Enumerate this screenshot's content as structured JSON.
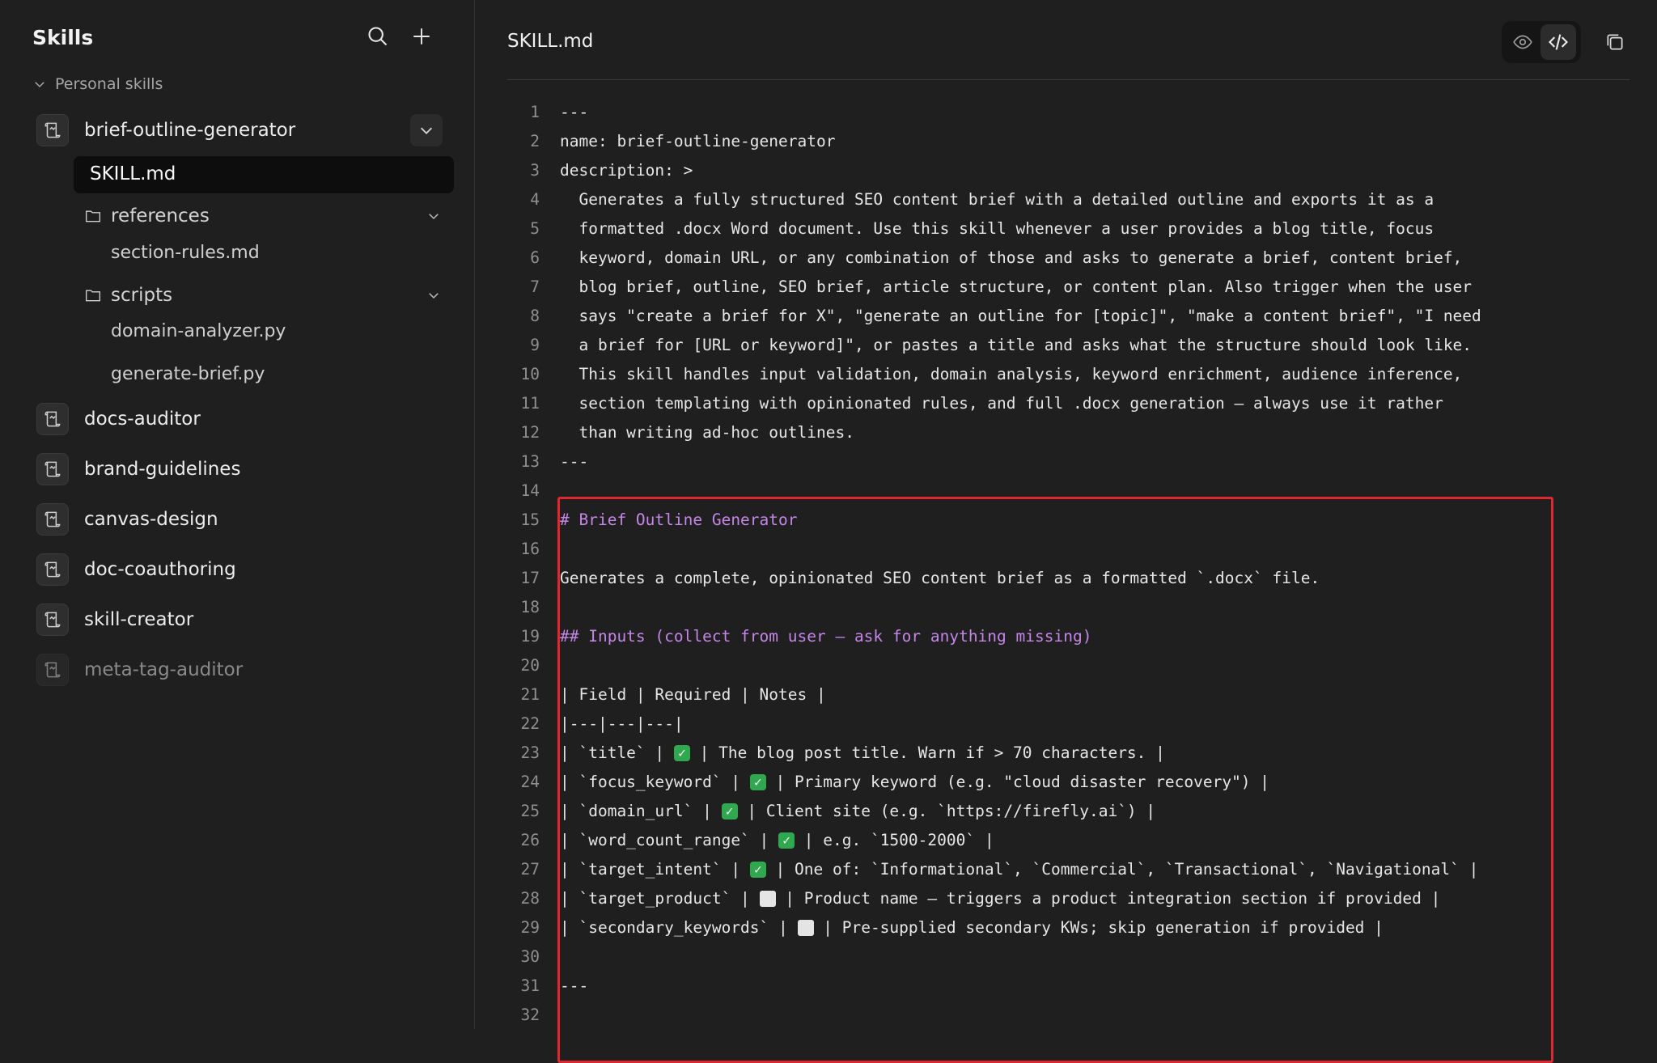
{
  "sidebar": {
    "title": "Skills",
    "section_label": "Personal skills",
    "skills": [
      {
        "label": "brief-outline-generator"
      },
      {
        "label": "docs-auditor"
      },
      {
        "label": "brand-guidelines"
      },
      {
        "label": "canvas-design"
      },
      {
        "label": "doc-coauthoring"
      },
      {
        "label": "skill-creator"
      },
      {
        "label": "meta-tag-auditor"
      }
    ],
    "files": {
      "active": "SKILL.md",
      "folder_references": "references",
      "file_section_rules": "section-rules.md",
      "folder_scripts": "scripts",
      "file_domain_analyzer": "domain-analyzer.py",
      "file_generate_brief": "generate-brief.py"
    }
  },
  "main": {
    "file_title": "SKILL.md"
  },
  "editor": {
    "lines": [
      {
        "n": "1",
        "t": "---"
      },
      {
        "n": "2",
        "t": "name: brief-outline-generator"
      },
      {
        "n": "3",
        "t": "description: >"
      },
      {
        "n": "4",
        "t": "  Generates a fully structured SEO content brief with a detailed outline and exports it as a"
      },
      {
        "n": "5",
        "t": "  formatted .docx Word document. Use this skill whenever a user provides a blog title, focus"
      },
      {
        "n": "6",
        "t": "  keyword, domain URL, or any combination of those and asks to generate a brief, content brief,"
      },
      {
        "n": "7",
        "t": "  blog brief, outline, SEO brief, article structure, or content plan. Also trigger when the user"
      },
      {
        "n": "8",
        "t": "  says \"create a brief for X\", \"generate an outline for [topic]\", \"make a content brief\", \"I need"
      },
      {
        "n": "9",
        "t": "  a brief for [URL or keyword]\", or pastes a title and asks what the structure should look like."
      },
      {
        "n": "10",
        "t": "  This skill handles input validation, domain analysis, keyword enrichment, audience inference,"
      },
      {
        "n": "11",
        "t": "  section templating with opinionated rules, and full .docx generation — always use it rather"
      },
      {
        "n": "12",
        "t": "  than writing ad-hoc outlines."
      },
      {
        "n": "13",
        "t": "---"
      },
      {
        "n": "14",
        "t": ""
      },
      {
        "n": "15",
        "t": "# Brief Outline Generator"
      },
      {
        "n": "16",
        "t": ""
      },
      {
        "n": "17",
        "t": "Generates a complete, opinionated SEO content brief as a formatted `.docx` file."
      },
      {
        "n": "18",
        "t": ""
      },
      {
        "n": "19",
        "t": "## Inputs (collect from user — ask for anything missing)"
      },
      {
        "n": "20",
        "t": ""
      },
      {
        "n": "21",
        "t": "| Field | Required | Notes |"
      },
      {
        "n": "22",
        "t": "|---|---|---|"
      },
      {
        "n": "23",
        "a": "| `title` | ",
        "b": " | The blog post title. Warn if > 70 characters. |"
      },
      {
        "n": "24",
        "a": "| `focus_keyword` | ",
        "b": " | Primary keyword (e.g. \"cloud disaster recovery\") |"
      },
      {
        "n": "25",
        "a": "| `domain_url` | ",
        "b": " | Client site (e.g. `https://firefly.ai`) |"
      },
      {
        "n": "26",
        "a": "| `word_count_range` | ",
        "b": " | e.g. `1500-2000` |"
      },
      {
        "n": "27",
        "a": "| `target_intent` | ",
        "b": " | One of: `Informational`, `Commercial`, `Transactional`, `Navigational` |"
      },
      {
        "n": "28",
        "a": "| `target_product` | ",
        "b": " | Product name — triggers a product integration section if provided |"
      },
      {
        "n": "29",
        "a": "| `secondary_keywords` | ",
        "b": " | Pre-supplied secondary KWs; skip generation if provided |"
      },
      {
        "n": "30",
        "t": ""
      },
      {
        "n": "31",
        "t": "---"
      },
      {
        "n": "32",
        "t": ""
      }
    ]
  },
  "colors": {
    "accent_highlight": "#e0262f",
    "heading": "#c586e8",
    "check": "#2fa84f"
  }
}
